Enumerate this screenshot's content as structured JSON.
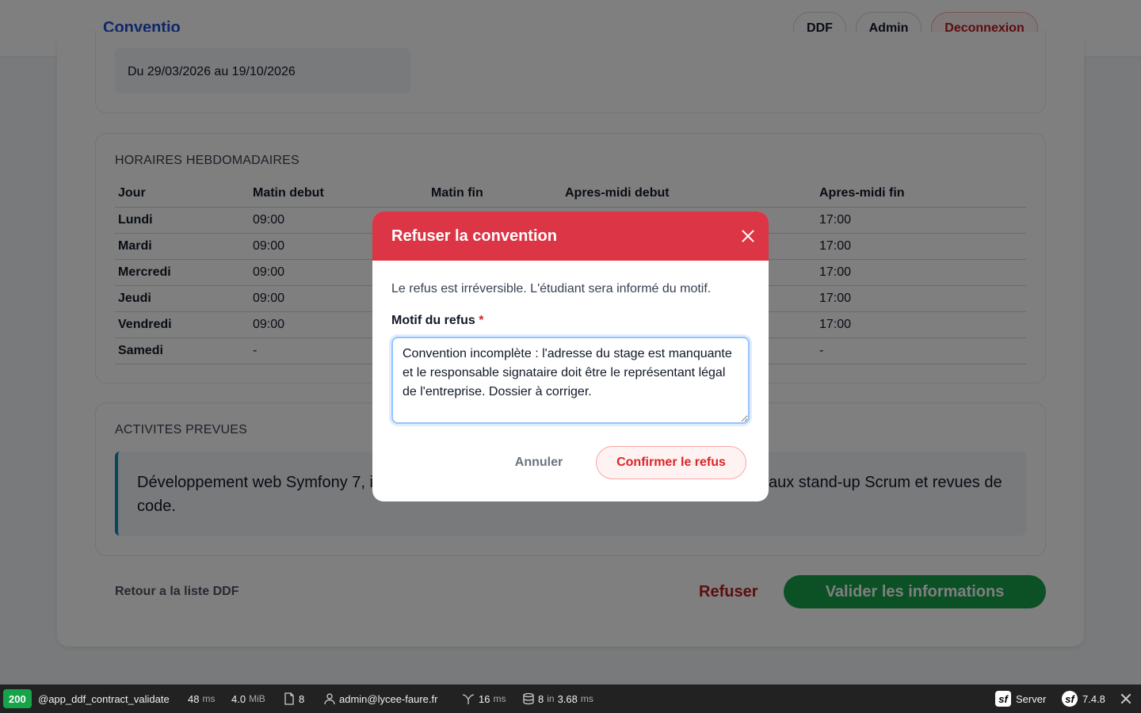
{
  "nav": {
    "brand": "Conventio",
    "buttons": {
      "ddf": "DDF",
      "admin": "Admin",
      "logout": "Deconnexion"
    }
  },
  "period": {
    "text": "Du 29/03/2026 au 19/10/2026"
  },
  "hours": {
    "title": "HORAIRES HEBDOMADAIRES",
    "columns": [
      "Jour",
      "Matin debut",
      "Matin fin",
      "Apres-midi debut",
      "Apres-midi fin"
    ],
    "rows": [
      [
        "Lundi",
        "09:00",
        "",
        "",
        "17:00"
      ],
      [
        "Mardi",
        "09:00",
        "",
        "",
        "17:00"
      ],
      [
        "Mercredi",
        "09:00",
        "",
        "",
        "17:00"
      ],
      [
        "Jeudi",
        "09:00",
        "",
        "",
        "17:00"
      ],
      [
        "Vendredi",
        "09:00",
        "",
        "",
        "17:00"
      ],
      [
        "Samedi",
        "-",
        "",
        "",
        "-"
      ]
    ]
  },
  "activities": {
    "title": "ACTIVITES PREVUES",
    "text_left": "Développement web Symfony 7, in",
    "text_right": "aux stand-up Scrum et revues de",
    "text_line2": "code."
  },
  "actions": {
    "back": "Retour a la liste DDF",
    "refuse": "Refuser",
    "validate": "Valider les informations"
  },
  "modal": {
    "title": "Refuser la convention",
    "description": "Le refus est irréversible. L'étudiant sera informé du motif.",
    "label": "Motif du refus",
    "required_mark": "*",
    "reason": "Convention incomplète : l'adresse du stage est manquante et le responsable signataire doit être le représentant légal de l'entreprise. Dossier à corriger.",
    "cancel": "Annuler",
    "confirm": "Confirmer le refus"
  },
  "debug": {
    "status": "200",
    "route": "@app_ddf_contract_validate",
    "time": "48",
    "time_unit": "ms",
    "memory": "4.0",
    "memory_unit": "MiB",
    "forms": "8",
    "user": "admin@lycee-faure.fr",
    "render_time": "16",
    "render_unit": "ms",
    "db_queries": "8",
    "db_in": "in",
    "db_time": "3.68",
    "db_unit": "ms",
    "server": "Server",
    "version": "7.4.8"
  },
  "colors": {
    "brand": "#1d4ed8",
    "danger": "#dc3545",
    "success": "#16a34a",
    "accent_border": "#0891b2"
  }
}
